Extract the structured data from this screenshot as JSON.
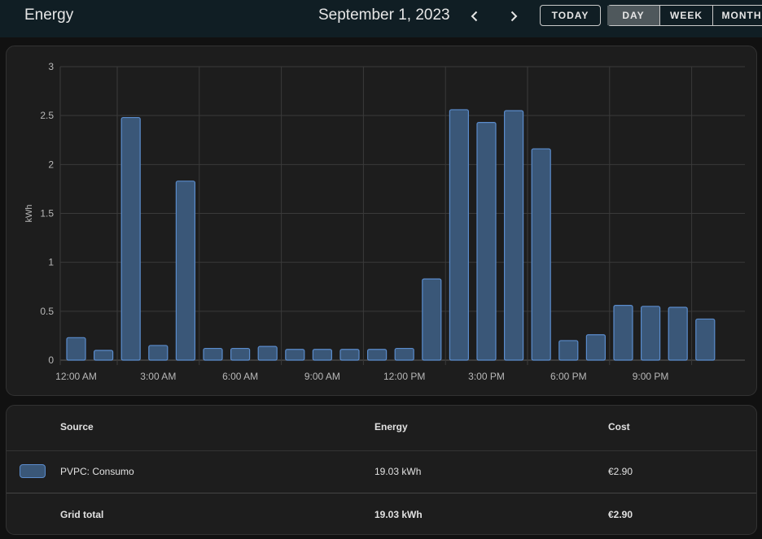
{
  "header": {
    "title": "Energy",
    "date": "September 1, 2023",
    "today_label": "TODAY",
    "periods": [
      "DAY",
      "WEEK",
      "MONTH"
    ],
    "selected_period": "DAY"
  },
  "chart_data": {
    "type": "bar",
    "ylabel": "kWh",
    "ylim": [
      0,
      3
    ],
    "yticks": [
      "0",
      "0.5",
      "1",
      "1.5",
      "2",
      "2.5",
      "3"
    ],
    "xticks": [
      "12:00 AM",
      "3:00 AM",
      "6:00 AM",
      "9:00 AM",
      "12:00 PM",
      "3:00 PM",
      "6:00 PM",
      "9:00 PM"
    ],
    "categories": [
      "0",
      "1",
      "2",
      "3",
      "4",
      "5",
      "6",
      "7",
      "8",
      "9",
      "10",
      "11",
      "12",
      "13",
      "14",
      "15",
      "16",
      "17",
      "18",
      "19",
      "20",
      "21",
      "22",
      "23"
    ],
    "series": [
      {
        "name": "PVPC: Consumo",
        "color": "#5b8ccc",
        "values": [
          0.23,
          0.1,
          2.48,
          0.15,
          1.83,
          0.12,
          0.12,
          0.14,
          0.11,
          0.11,
          0.11,
          0.11,
          0.12,
          0.83,
          2.56,
          2.43,
          2.55,
          2.16,
          0.2,
          0.26,
          0.56,
          0.55,
          0.54,
          0.42
        ]
      }
    ],
    "grid": true
  },
  "table": {
    "headers": {
      "source": "Source",
      "energy": "Energy",
      "cost": "Cost"
    },
    "rows": [
      {
        "source": "PVPC: Consumo",
        "energy": "19.03 kWh",
        "cost": "€2.90",
        "color": "#5b8ccc"
      }
    ],
    "total": {
      "label": "Grid total",
      "energy": "19.03 kWh",
      "cost": "€2.90"
    }
  },
  "icons": [
    "chevron-left-icon",
    "chevron-right-icon"
  ]
}
